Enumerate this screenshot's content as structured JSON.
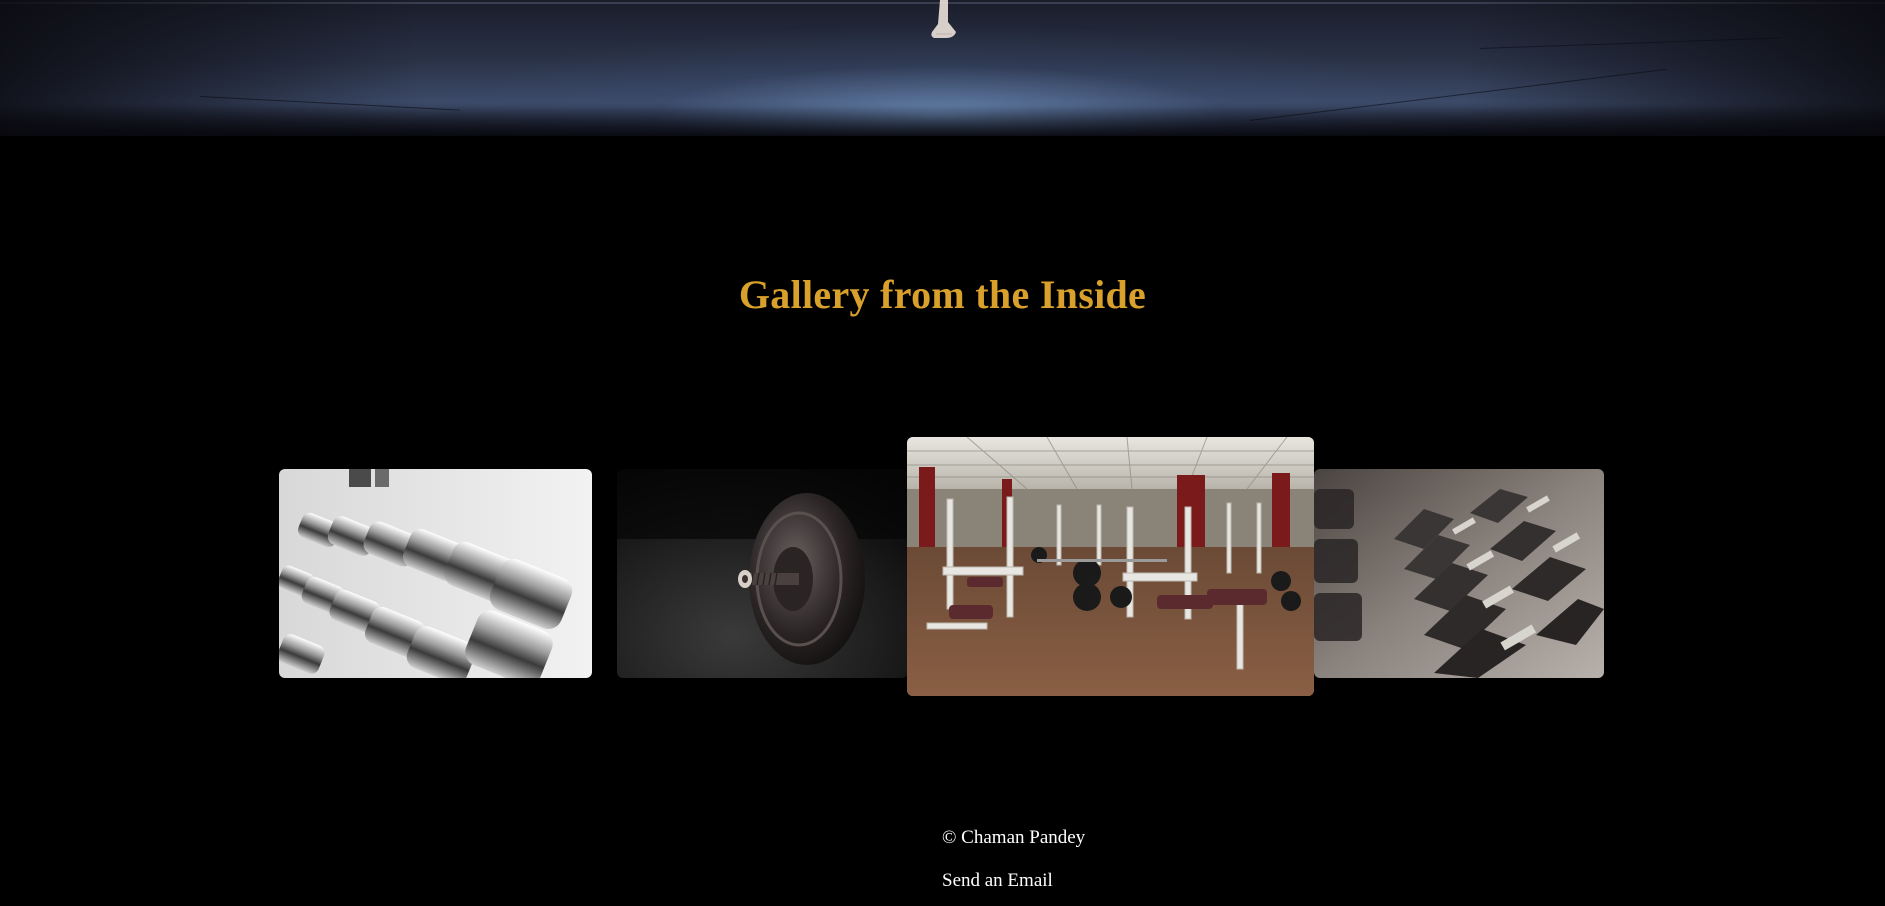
{
  "hero": {
    "image": "stage-performer-feet-image"
  },
  "gallery": {
    "title": "Gallery from the Inside",
    "title_color": "#d9a12b",
    "images": [
      {
        "name": "chrome-dumbbells-rack-image",
        "highlighted": false
      },
      {
        "name": "barbell-plate-on-floor-image",
        "highlighted": false
      },
      {
        "name": "gym-interior-equipment-image",
        "highlighted": true
      },
      {
        "name": "hex-dumbbells-row-image",
        "highlighted": false
      }
    ]
  },
  "footer": {
    "copyright": "© Chaman Pandey",
    "email_link": "Send an Email"
  },
  "colors": {
    "background": "#000000",
    "footer_text": "#ffffff"
  }
}
